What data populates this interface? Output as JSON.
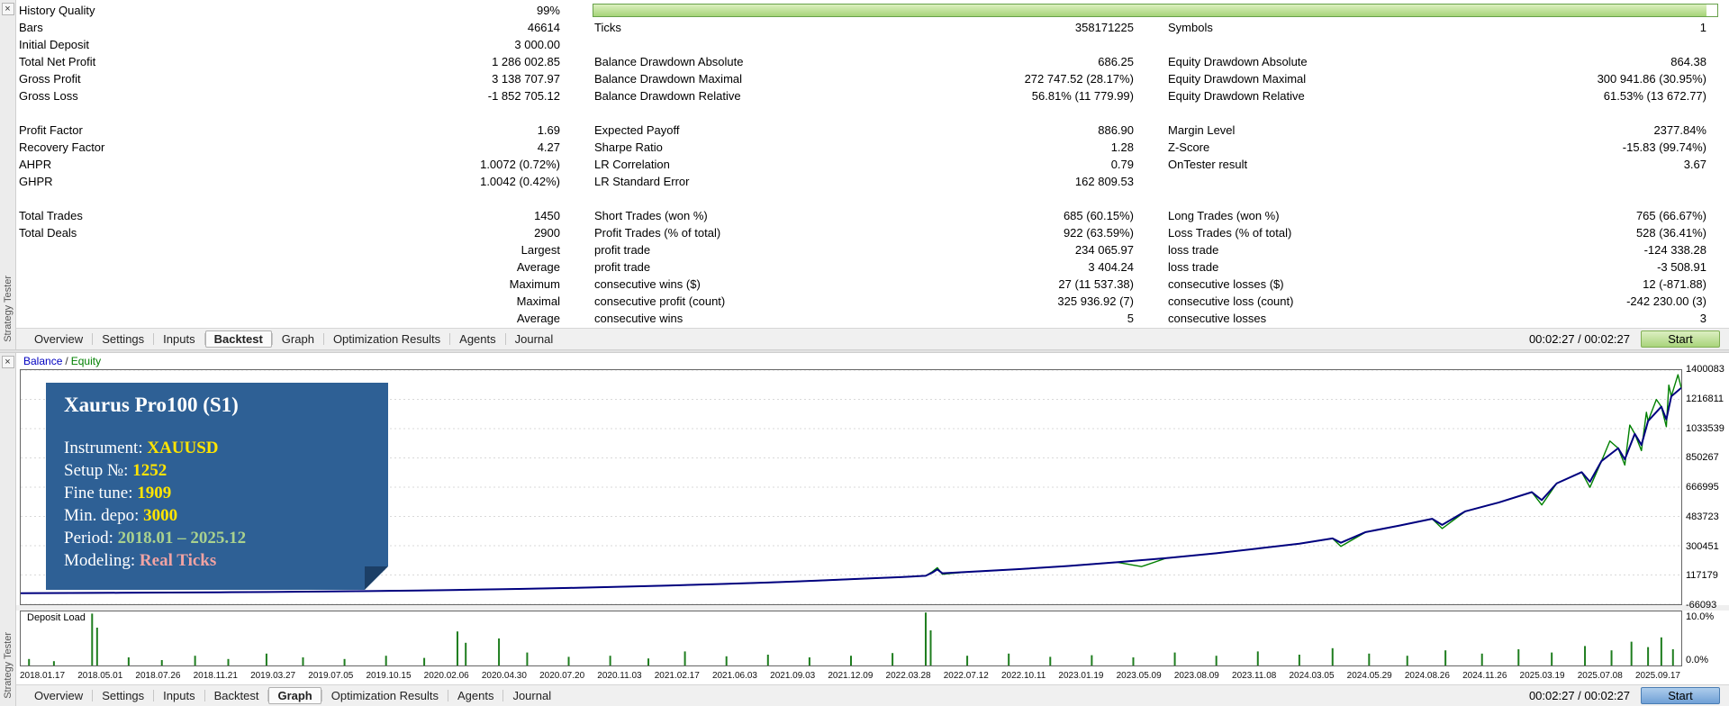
{
  "side_strip": {
    "label": "Strategy Tester",
    "close_icon": "×"
  },
  "top_panel": {
    "history_quality": {
      "label": "History Quality",
      "value": "99%",
      "bar_pct": 99
    },
    "rows": [
      {
        "c1l": "Bars",
        "c1v": "46614",
        "c2l": "Ticks",
        "c2v": "358171225",
        "c3l": "Symbols",
        "c3v": "1"
      },
      {
        "c1l": "Initial Deposit",
        "c1v": "3 000.00",
        "c2l": "",
        "c2v": "",
        "c3l": "",
        "c3v": ""
      },
      {
        "c1l": "Total Net Profit",
        "c1v": "1 286 002.85",
        "c2l": "Balance Drawdown Absolute",
        "c2v": "686.25",
        "c3l": "Equity Drawdown Absolute",
        "c3v": "864.38"
      },
      {
        "c1l": "Gross Profit",
        "c1v": "3 138 707.97",
        "c2l": "Balance Drawdown Maximal",
        "c2v": "272 747.52 (28.17%)",
        "c3l": "Equity Drawdown Maximal",
        "c3v": "300 941.86 (30.95%)"
      },
      {
        "c1l": "Gross Loss",
        "c1v": "-1 852 705.12",
        "c2l": "Balance Drawdown Relative",
        "c2v": "56.81% (11 779.99)",
        "c3l": "Equity Drawdown Relative",
        "c3v": "61.53% (13 672.77)"
      },
      {},
      {
        "c1l": "Profit Factor",
        "c1v": "1.69",
        "c2l": "Expected Payoff",
        "c2v": "886.90",
        "c3l": "Margin Level",
        "c3v": "2377.84%"
      },
      {
        "c1l": "Recovery Factor",
        "c1v": "4.27",
        "c2l": "Sharpe Ratio",
        "c2v": "1.28",
        "c3l": "Z-Score",
        "c3v": "-15.83 (99.74%)"
      },
      {
        "c1l": "AHPR",
        "c1v": "1.0072 (0.72%)",
        "c2l": "LR Correlation",
        "c2v": "0.79",
        "c3l": "OnTester result",
        "c3v": "3.67"
      },
      {
        "c1l": "GHPR",
        "c1v": "1.0042 (0.42%)",
        "c2l": "LR Standard Error",
        "c2v": "162 809.53",
        "c3l": "",
        "c3v": ""
      },
      {},
      {
        "c1l": "Total Trades",
        "c1v": "1450",
        "c2l": "Short Trades (won %)",
        "c2v": "685 (60.15%)",
        "c3l": "Long Trades (won %)",
        "c3v": "765 (66.67%)"
      },
      {
        "c1l": "Total Deals",
        "c1v": "2900",
        "c2l": "Profit Trades (% of total)",
        "c2v": "922 (63.59%)",
        "c3l": "Loss Trades (% of total)",
        "c3v": "528 (36.41%)"
      },
      {
        "c1l": "",
        "c1v": "Largest",
        "c2l": "profit trade",
        "c2v": "234 065.97",
        "c3l": "loss trade",
        "c3v": "-124 338.28"
      },
      {
        "c1l": "",
        "c1v": "Average",
        "c2l": "profit trade",
        "c2v": "3 404.24",
        "c3l": "loss trade",
        "c3v": "-3 508.91"
      },
      {
        "c1l": "",
        "c1v": "Maximum",
        "c2l": "consecutive wins ($)",
        "c2v": "27 (11 537.38)",
        "c3l": "consecutive losses ($)",
        "c3v": "12 (-871.88)"
      },
      {
        "c1l": "",
        "c1v": "Maximal",
        "c2l": "consecutive profit (count)",
        "c2v": "325 936.92 (7)",
        "c3l": "consecutive loss (count)",
        "c3v": "-242 230.00 (3)"
      },
      {
        "c1l": "",
        "c1v": "Average",
        "c2l": "consecutive wins",
        "c2v": "5",
        "c3l": "consecutive losses",
        "c3v": "3"
      }
    ]
  },
  "tab_bar": {
    "tabs": [
      "Overview",
      "Settings",
      "Inputs",
      "Backtest",
      "Graph",
      "Optimization Results",
      "Agents",
      "Journal"
    ],
    "top_active": "Backtest",
    "bottom_active": "Graph",
    "timer": "00:02:27 / 00:02:27",
    "start_label": "Start"
  },
  "chart_data": {
    "type": "line",
    "title": "Balance / Equity",
    "legend": [
      {
        "name": "Balance",
        "color": "#0000c0"
      },
      {
        "name": "Equity",
        "color": "#008000"
      }
    ],
    "legend_separator": "/",
    "ylim": [
      -66093,
      1400083
    ],
    "y_ticks": [
      1400083,
      1216811,
      1033539,
      850267,
      666995,
      483723,
      300451,
      117179,
      -66093
    ],
    "x_labels": [
      "2018.01.17",
      "2018.05.01",
      "2018.07.26",
      "2018.11.21",
      "2019.03.27",
      "2019.07.05",
      "2019.10.15",
      "2020.02.06",
      "2020.04.30",
      "2020.07.20",
      "2020.11.03",
      "2021.02.17",
      "2021.06.03",
      "2021.09.03",
      "2021.12.09",
      "2022.03.28",
      "2022.07.12",
      "2022.10.11",
      "2023.01.19",
      "2023.05.09",
      "2023.08.09",
      "2023.11.08",
      "2024.03.05",
      "2024.05.29",
      "2024.08.26",
      "2024.11.26",
      "2025.03.19",
      "2025.07.08",
      "2025.09.17"
    ],
    "series": [
      {
        "name": "Equity",
        "color": "#008000",
        "width": 1.4,
        "points": [
          [
            0,
            3000
          ],
          [
            0.03,
            4200
          ],
          [
            0.06,
            5600
          ],
          [
            0.09,
            7200
          ],
          [
            0.12,
            9000
          ],
          [
            0.15,
            11000
          ],
          [
            0.18,
            13500
          ],
          [
            0.21,
            16500
          ],
          [
            0.24,
            20000
          ],
          [
            0.27,
            24500
          ],
          [
            0.3,
            30000
          ],
          [
            0.33,
            36000
          ],
          [
            0.36,
            43000
          ],
          [
            0.39,
            51000
          ],
          [
            0.42,
            60000
          ],
          [
            0.45,
            70000
          ],
          [
            0.48,
            82000
          ],
          [
            0.51,
            95000
          ],
          [
            0.53,
            104000
          ],
          [
            0.545,
            112000
          ],
          [
            0.549,
            138000
          ],
          [
            0.552,
            163000
          ],
          [
            0.555,
            122000
          ],
          [
            0.57,
            136000
          ],
          [
            0.6,
            153000
          ],
          [
            0.63,
            173000
          ],
          [
            0.66,
            197000
          ],
          [
            0.675,
            170000
          ],
          [
            0.69,
            223000
          ],
          [
            0.72,
            253000
          ],
          [
            0.75,
            289000
          ],
          [
            0.77,
            313000
          ],
          [
            0.79,
            346000
          ],
          [
            0.795,
            296000
          ],
          [
            0.81,
            386000
          ],
          [
            0.83,
            426000
          ],
          [
            0.85,
            469000
          ],
          [
            0.856,
            408000
          ],
          [
            0.87,
            516000
          ],
          [
            0.89,
            571000
          ],
          [
            0.91,
            636000
          ],
          [
            0.916,
            556000
          ],
          [
            0.925,
            691000
          ],
          [
            0.94,
            761000
          ],
          [
            0.945,
            666000
          ],
          [
            0.952,
            831000
          ],
          [
            0.957,
            956000
          ],
          [
            0.962,
            911000
          ],
          [
            0.966,
            806000
          ],
          [
            0.969,
            1056000
          ],
          [
            0.972,
            1001000
          ],
          [
            0.976,
            896000
          ],
          [
            0.979,
            1136000
          ],
          [
            0.98,
            1081000
          ],
          [
            0.985,
            1216000
          ],
          [
            0.988,
            1171000
          ],
          [
            0.991,
            1046000
          ],
          [
            0.9925,
            1306000
          ],
          [
            0.994,
            1236000
          ],
          [
            0.998,
            1371000
          ],
          [
            1,
            1290000
          ]
        ]
      },
      {
        "name": "Balance",
        "color": "#00007f",
        "width": 2,
        "points": [
          [
            0,
            3000
          ],
          [
            0.03,
            4200
          ],
          [
            0.06,
            5600
          ],
          [
            0.09,
            7200
          ],
          [
            0.12,
            9000
          ],
          [
            0.15,
            11000
          ],
          [
            0.18,
            13500
          ],
          [
            0.21,
            16500
          ],
          [
            0.24,
            20000
          ],
          [
            0.27,
            24500
          ],
          [
            0.3,
            30000
          ],
          [
            0.33,
            36000
          ],
          [
            0.36,
            43000
          ],
          [
            0.39,
            51000
          ],
          [
            0.42,
            60000
          ],
          [
            0.45,
            70000
          ],
          [
            0.48,
            82000
          ],
          [
            0.51,
            95000
          ],
          [
            0.53,
            104000
          ],
          [
            0.545,
            112000
          ],
          [
            0.549,
            132000
          ],
          [
            0.552,
            152000
          ],
          [
            0.555,
            128000
          ],
          [
            0.57,
            136000
          ],
          [
            0.6,
            153000
          ],
          [
            0.63,
            173000
          ],
          [
            0.66,
            197000
          ],
          [
            0.69,
            223000
          ],
          [
            0.72,
            253000
          ],
          [
            0.75,
            289000
          ],
          [
            0.77,
            313000
          ],
          [
            0.79,
            346000
          ],
          [
            0.795,
            319000
          ],
          [
            0.81,
            386000
          ],
          [
            0.83,
            426000
          ],
          [
            0.85,
            469000
          ],
          [
            0.856,
            431000
          ],
          [
            0.87,
            516000
          ],
          [
            0.89,
            571000
          ],
          [
            0.91,
            636000
          ],
          [
            0.916,
            586000
          ],
          [
            0.925,
            691000
          ],
          [
            0.94,
            761000
          ],
          [
            0.945,
            701000
          ],
          [
            0.952,
            831000
          ],
          [
            0.962,
            911000
          ],
          [
            0.966,
            841000
          ],
          [
            0.972,
            1001000
          ],
          [
            0.976,
            931000
          ],
          [
            0.98,
            1081000
          ],
          [
            0.988,
            1171000
          ],
          [
            0.991,
            1091000
          ],
          [
            0.994,
            1236000
          ],
          [
            1,
            1289003
          ]
        ]
      }
    ],
    "deposit_load": {
      "label": "Deposit Load",
      "y_max_label": "10.0%",
      "y_min_label": "0.0%",
      "ylim": [
        0,
        10
      ],
      "color": "#1e7d1e",
      "bars": [
        [
          0.005,
          1.2
        ],
        [
          0.02,
          0.8
        ],
        [
          0.043,
          9.6
        ],
        [
          0.046,
          7.0
        ],
        [
          0.065,
          1.5
        ],
        [
          0.085,
          1.0
        ],
        [
          0.105,
          1.8
        ],
        [
          0.125,
          1.2
        ],
        [
          0.148,
          2.2
        ],
        [
          0.17,
          1.5
        ],
        [
          0.195,
          1.2
        ],
        [
          0.22,
          1.8
        ],
        [
          0.243,
          1.4
        ],
        [
          0.263,
          6.3
        ],
        [
          0.268,
          4.2
        ],
        [
          0.288,
          5.0
        ],
        [
          0.305,
          2.4
        ],
        [
          0.33,
          1.6
        ],
        [
          0.355,
          1.8
        ],
        [
          0.378,
          1.3
        ],
        [
          0.4,
          2.6
        ],
        [
          0.425,
          1.7
        ],
        [
          0.45,
          2.0
        ],
        [
          0.475,
          1.5
        ],
        [
          0.5,
          1.8
        ],
        [
          0.525,
          2.3
        ],
        [
          0.545,
          9.8
        ],
        [
          0.548,
          6.5
        ],
        [
          0.57,
          1.8
        ],
        [
          0.595,
          2.2
        ],
        [
          0.62,
          1.6
        ],
        [
          0.645,
          1.9
        ],
        [
          0.67,
          1.5
        ],
        [
          0.695,
          2.4
        ],
        [
          0.72,
          1.8
        ],
        [
          0.745,
          2.6
        ],
        [
          0.77,
          2.0
        ],
        [
          0.79,
          3.2
        ],
        [
          0.812,
          2.2
        ],
        [
          0.835,
          1.8
        ],
        [
          0.858,
          2.8
        ],
        [
          0.88,
          2.2
        ],
        [
          0.902,
          3.0
        ],
        [
          0.922,
          2.4
        ],
        [
          0.942,
          3.6
        ],
        [
          0.958,
          2.8
        ],
        [
          0.97,
          4.4
        ],
        [
          0.98,
          3.4
        ],
        [
          0.988,
          5.2
        ],
        [
          0.995,
          3.0
        ]
      ]
    },
    "info_box": {
      "title": "Xaurus Pro100 (S1)",
      "lines": [
        {
          "label": "Instrument: ",
          "value": "XAUUSD",
          "color": "#ffe400"
        },
        {
          "label": "Setup №: ",
          "value": "1252",
          "color": "#ffe400"
        },
        {
          "label": "Fine tune: ",
          "value": "1909",
          "color": "#ffe400"
        },
        {
          "label": "Min. depo: ",
          "value": "3000",
          "color": "#ffe400"
        },
        {
          "label": "Period: ",
          "value": "2018.01 – 2025.12",
          "color": "#a9d18e"
        },
        {
          "label": "Modeling: ",
          "value": "Real Ticks",
          "color": "#f1a3a3"
        }
      ]
    }
  }
}
